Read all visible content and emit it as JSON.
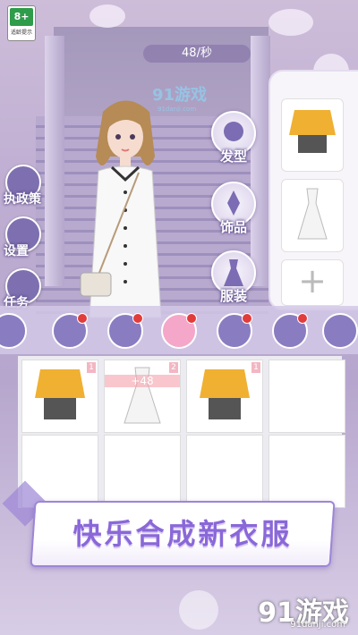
{
  "age_badge": {
    "rating": "8+",
    "caption": "适龄提示"
  },
  "timer": {
    "text": "48/秒"
  },
  "watermark": {
    "brand": "91游戏",
    "url": "91danji.com"
  },
  "left_menu": [
    {
      "label": "执政策",
      "icon": "house-icon"
    },
    {
      "label": "设置",
      "icon": "gear-icon"
    },
    {
      "label": "任务",
      "icon": "list-icon"
    }
  ],
  "categories": [
    {
      "label": "发型",
      "icon": "hair-icon"
    },
    {
      "label": "饰品",
      "icon": "accessory-icon"
    },
    {
      "label": "服装",
      "icon": "dress-icon"
    }
  ],
  "right_items": [
    {
      "name": "yellow-hoodie-outfit"
    },
    {
      "name": "white-dress"
    },
    {
      "name": "add",
      "symbol": "+"
    }
  ],
  "tabs": [
    {
      "name": "tab-all",
      "badge": false
    },
    {
      "name": "tab-hair",
      "badge": true
    },
    {
      "name": "tab-accessory",
      "badge": true
    },
    {
      "name": "tab-dress",
      "badge": true,
      "selected": true
    },
    {
      "name": "tab-top",
      "badge": true
    },
    {
      "name": "tab-shoes",
      "badge": true
    },
    {
      "name": "tab-more",
      "badge": false
    }
  ],
  "grid_items": [
    {
      "item": "yellow-hoodie-outfit",
      "tag": "1"
    },
    {
      "item": "white-dress",
      "tag": "2",
      "overlay": "+48"
    },
    {
      "item": "yellow-hoodie-outfit",
      "tag": "1"
    },
    {
      "item": "",
      "tag": ""
    },
    {
      "item": "",
      "tag": ""
    },
    {
      "item": "",
      "tag": ""
    },
    {
      "item": "",
      "tag": ""
    },
    {
      "item": "",
      "tag": ""
    }
  ],
  "banner": {
    "text": "快乐合成新衣服"
  },
  "footer_logo": {
    "brand": "91游戏",
    "url": "91danji.com"
  },
  "colors": {
    "accent": "#8a68d8",
    "panel": "#f7f5fa",
    "tab": "#8a7cc0",
    "selected": "#f4a7c8"
  }
}
